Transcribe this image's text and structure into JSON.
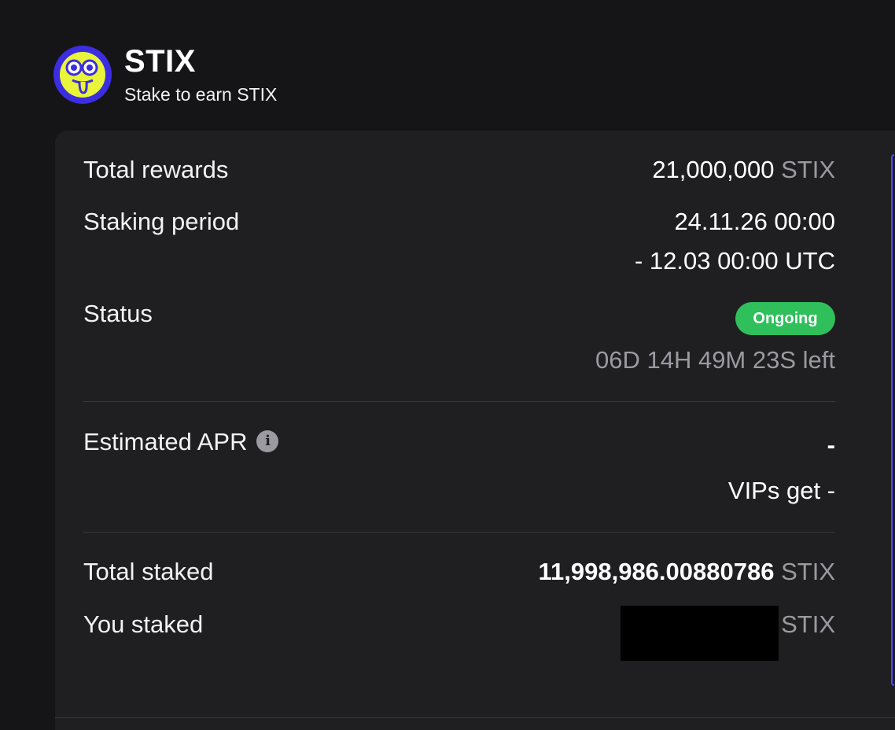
{
  "header": {
    "title": "STIX",
    "subtitle": "Stake to earn STIX",
    "logo_icon": "stix-mascot-icon"
  },
  "colors": {
    "background": "#151517",
    "card": "#1f1f22",
    "muted_text": "#9a9aa0",
    "status_green": "#2fbf5b",
    "accent_border": "#4f4df0"
  },
  "rows": {
    "total_rewards": {
      "label": "Total rewards",
      "value": "21,000,000",
      "unit": "STIX"
    },
    "staking_period": {
      "label": "Staking period",
      "start": "24.11.26 00:00",
      "end": "- 12.03 00:00 UTC"
    },
    "status": {
      "label": "Status",
      "badge": "Ongoing",
      "time_left": "06D 14H 49M 23S left"
    },
    "estimated_apr": {
      "label": "Estimated APR",
      "value": "-",
      "vip": "VIPs get -",
      "info_icon": "info-icon"
    },
    "total_staked": {
      "label": "Total staked",
      "value": "11,998,986.00880786",
      "unit": "STIX"
    },
    "you_staked": {
      "label": "You staked",
      "value": "",
      "unit": "STIX"
    }
  }
}
